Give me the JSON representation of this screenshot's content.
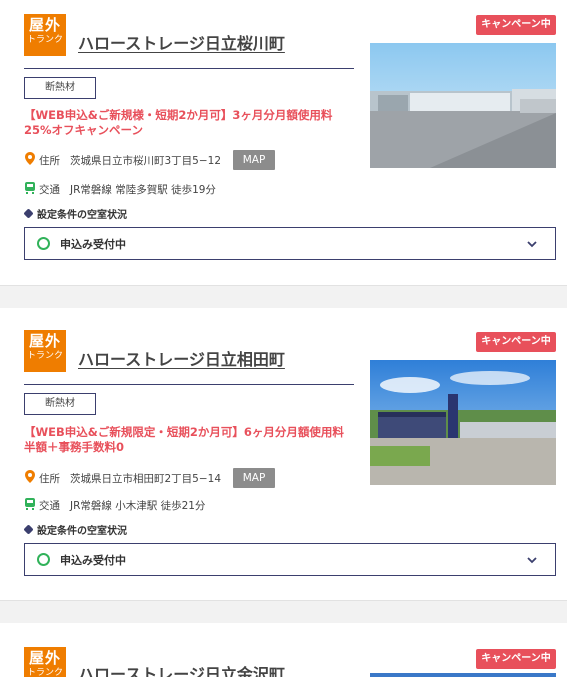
{
  "listings": [
    {
      "type_badge": {
        "main": "屋外",
        "sub": "トランク"
      },
      "title": "ハローストレージ日立桜川町",
      "campaign": "キャンペーン中",
      "tag": "断熱材",
      "promo": "【WEB申込&ご新規様・短期2か月可】3ヶ月分月額使用料25%オフキャンペーン",
      "address_label": "住所",
      "address": "茨城県日立市桜川町3丁目5−12",
      "map_label": "MAP",
      "access_label": "交通",
      "access": "JR常磐線 常陸多賀駅 徒歩19分",
      "condition_label": "設定条件の空室状況",
      "status": "申込み受付中"
    },
    {
      "type_badge": {
        "main": "屋外",
        "sub": "トランク"
      },
      "title": "ハローストレージ日立相田町",
      "campaign": "キャンペーン中",
      "tag": "断熱材",
      "promo": "【WEB申込&ご新規限定・短期2か月可】6ヶ月分月額使用料半額＋事務手数料0",
      "address_label": "住所",
      "address": "茨城県日立市相田町2丁目5−14",
      "map_label": "MAP",
      "access_label": "交通",
      "access": "JR常磐線 小木津駅 徒歩21分",
      "condition_label": "設定条件の空室状況",
      "status": "申込み受付中"
    },
    {
      "type_badge": {
        "main": "屋外",
        "sub": "トランク"
      },
      "title": "ハローストレージ日立金沢町",
      "campaign": "キャンペーン中"
    }
  ]
}
